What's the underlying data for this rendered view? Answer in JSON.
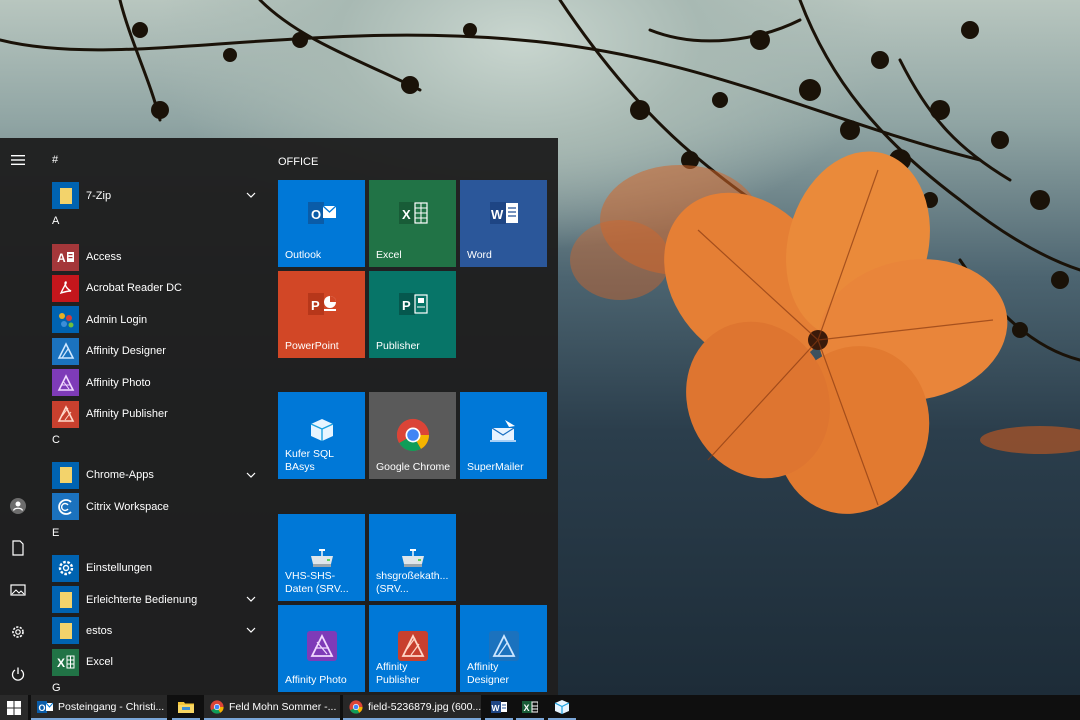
{
  "start_menu": {
    "app_list": [
      {
        "type": "letter",
        "label": "#"
      },
      {
        "type": "app",
        "label": "7-Zip",
        "icon": "folder-icon",
        "expandable": true
      },
      {
        "type": "letter",
        "label": "A"
      },
      {
        "type": "app",
        "label": "Access",
        "icon": "access-icon"
      },
      {
        "type": "app",
        "label": "Acrobat Reader DC",
        "icon": "acrobat-icon"
      },
      {
        "type": "app",
        "label": "Admin  Login",
        "icon": "admin-login-icon"
      },
      {
        "type": "app",
        "label": "Affinity Designer",
        "icon": "affinity-designer-icon"
      },
      {
        "type": "app",
        "label": "Affinity Photo",
        "icon": "affinity-photo-icon"
      },
      {
        "type": "app",
        "label": "Affinity Publisher",
        "icon": "affinity-publisher-icon"
      },
      {
        "type": "letter",
        "label": "C"
      },
      {
        "type": "app",
        "label": "Chrome-Apps",
        "icon": "folder-icon",
        "expandable": true
      },
      {
        "type": "app",
        "label": "Citrix Workspace",
        "icon": "citrix-icon"
      },
      {
        "type": "letter",
        "label": "E"
      },
      {
        "type": "app",
        "label": "Einstellungen",
        "icon": "settings-gear-icon"
      },
      {
        "type": "app",
        "label": "Erleichterte Bedienung",
        "icon": "folder-icon",
        "expandable": true
      },
      {
        "type": "app",
        "label": "estos",
        "icon": "folder-icon",
        "expandable": true
      },
      {
        "type": "app",
        "label": "Excel",
        "icon": "excel-icon"
      },
      {
        "type": "letter",
        "label": "G"
      }
    ],
    "groups": [
      {
        "title": "OFFICE"
      }
    ],
    "tiles": [
      {
        "label": "Outlook",
        "icon": "outlook-icon",
        "color": "#0078d7"
      },
      {
        "label": "Excel",
        "icon": "excel-icon",
        "color": "#217346"
      },
      {
        "label": "Word",
        "icon": "word-icon",
        "color": "#2b579a"
      },
      {
        "label": "PowerPoint",
        "icon": "powerpoint-icon",
        "color": "#d24726"
      },
      {
        "label": "Publisher",
        "icon": "publisher-icon",
        "color": "#077568"
      },
      {
        "label": "Kufer SQL BAsys",
        "icon": "kufer-icon",
        "color": "#0078d7"
      },
      {
        "label": "Google Chrome",
        "icon": "chrome-icon",
        "color": "#5a5a5a"
      },
      {
        "label": "SuperMailer",
        "icon": "supermailer-icon",
        "color": "#0078d7"
      },
      {
        "label": "VHS-SHS-Daten (SRV...",
        "icon": "network-drive-icon",
        "color": "#0078d7"
      },
      {
        "label": "shsgroßekath... (SRV...",
        "icon": "network-drive-icon",
        "color": "#0078d7"
      },
      {
        "label": "Affinity Photo",
        "icon": "affinity-photo-icon",
        "color": "#0078d7"
      },
      {
        "label": "Affinity Publisher",
        "icon": "affinity-publisher-icon",
        "color": "#0078d7"
      },
      {
        "label": "Affinity Designer",
        "icon": "affinity-designer-icon",
        "color": "#0078d7"
      }
    ]
  },
  "taskbar": {
    "items": [
      {
        "label": "Posteingang - Christi...",
        "icon": "outlook-icon"
      },
      {
        "label": "",
        "icon": "file-explorer-icon"
      },
      {
        "label": "Feld Mohn Sommer -...",
        "icon": "chrome-icon"
      },
      {
        "label": "field-5236879.jpg (600...",
        "icon": "chrome-icon"
      },
      {
        "label": "",
        "icon": "word-icon"
      },
      {
        "label": "",
        "icon": "excel-icon"
      },
      {
        "label": "",
        "icon": "kufer-icon"
      }
    ]
  },
  "colors": {
    "accent": "#0078d7",
    "menu_bg": "#1f1f1f",
    "taskbar_bg": "#0f0f0f"
  }
}
